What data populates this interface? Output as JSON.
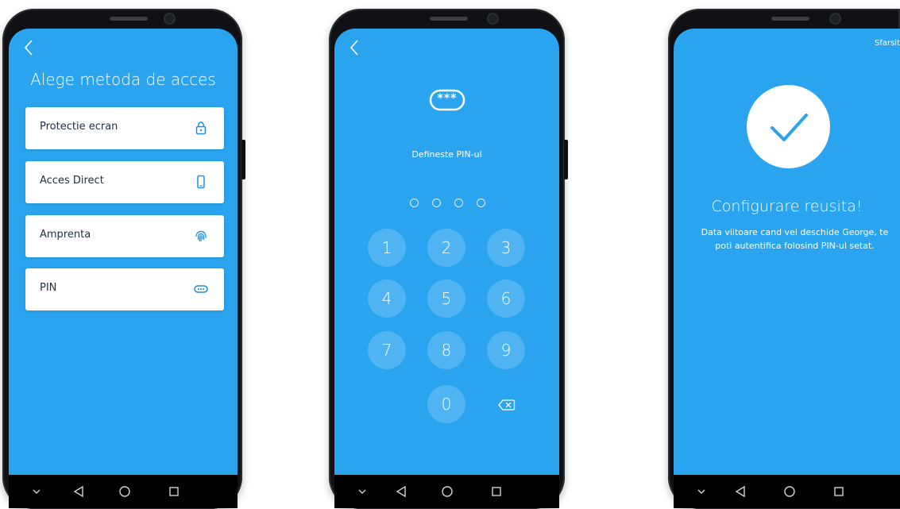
{
  "colors": {
    "screen_bg": "#2aa4ef",
    "phone_body": "#101114",
    "card_bg": "#ffffff",
    "navbar": "#000000"
  },
  "screen1": {
    "title": "Alege metoda de acces",
    "methods": [
      {
        "label": "Protectie ecran",
        "icon": "lock-icon"
      },
      {
        "label": "Acces Direct",
        "icon": "phone-icon"
      },
      {
        "label": "Amprenta",
        "icon": "fingerprint-icon"
      },
      {
        "label": "PIN",
        "icon": "pin-dots-icon"
      }
    ]
  },
  "screen2": {
    "badge": "***",
    "subtitle": "Defineste PIN-ul",
    "pin_length": 4,
    "keys": [
      "1",
      "2",
      "3",
      "4",
      "5",
      "6",
      "7",
      "8",
      "9",
      "0"
    ]
  },
  "screen3": {
    "finish_label": "Sfarsit",
    "title": "Configurare reusita!",
    "message_line1": "Data viitoare cand vei deschide George, te",
    "message_line2": "poti autentifica folosind PIN-ul setat."
  },
  "navbar": {
    "icons": [
      "chevron-down-icon",
      "back-triangle-icon",
      "home-circle-icon",
      "recents-square-icon"
    ]
  }
}
